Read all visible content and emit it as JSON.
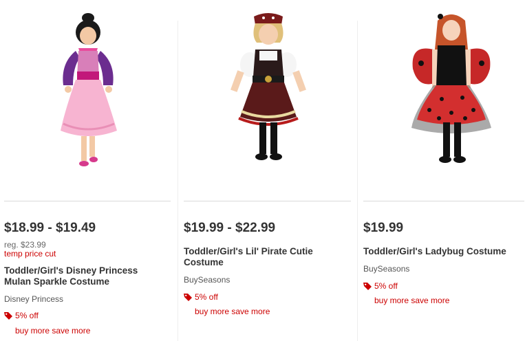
{
  "products": [
    {
      "price": "$18.99 - $19.49",
      "reg_price": "reg. $23.99",
      "price_note": "temp price cut",
      "title": "Toddler/Girl's Disney Princess Mulan Sparkle Costume",
      "brand": "Disney Princess",
      "promo": "5% off",
      "promo_link": "buy more save more",
      "image_icon": "costume-photo-mulan"
    },
    {
      "price": "$19.99 - $22.99",
      "title": "Toddler/Girl's Lil' Pirate Cutie Costume",
      "brand": "BuySeasons",
      "promo": "5% off",
      "promo_link": "buy more save more",
      "image_icon": "costume-photo-pirate"
    },
    {
      "price": "$19.99",
      "title": "Toddler/Girl's Ladybug Costume",
      "brand": "BuySeasons",
      "promo": "5% off",
      "promo_link": "buy more save more",
      "image_icon": "costume-photo-ladybug"
    }
  ],
  "colors": {
    "accent_red": "#cc0000",
    "text_dark": "#333333",
    "divider": "#d9d9d9"
  },
  "icons": {
    "promo": "price-tag-icon"
  }
}
